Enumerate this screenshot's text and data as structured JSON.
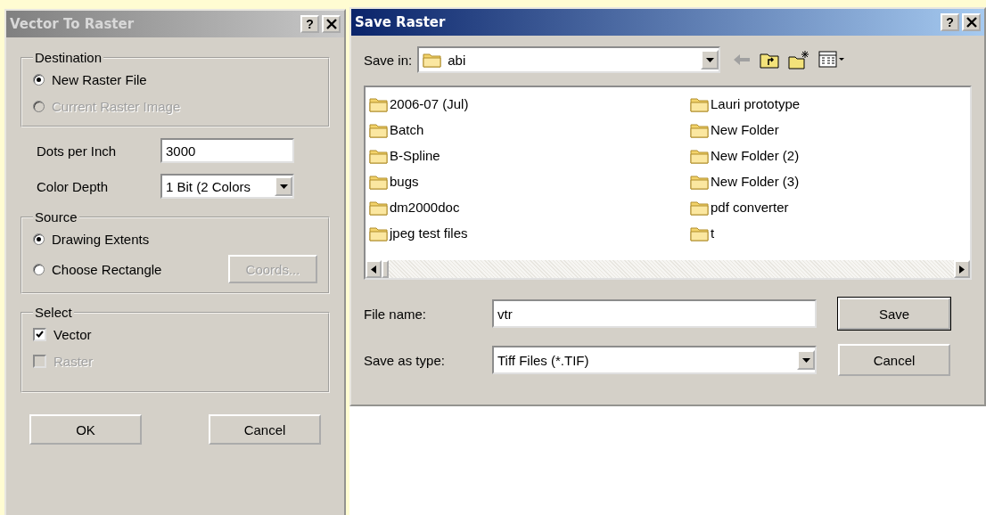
{
  "vector_to_raster": {
    "title": "Vector To Raster",
    "help": "?",
    "destination": {
      "label": "Destination",
      "options": [
        {
          "label": "New Raster File",
          "selected": true,
          "disabled": false
        },
        {
          "label": "Current Raster Image",
          "selected": false,
          "disabled": true
        }
      ]
    },
    "dpi": {
      "label": "Dots per Inch",
      "value": "3000"
    },
    "color_depth": {
      "label": "Color Depth",
      "value": "1 Bit (2 Colors"
    },
    "source": {
      "label": "Source",
      "options": [
        {
          "label": "Drawing Extents",
          "selected": true,
          "disabled": false
        },
        {
          "label": "Choose Rectangle",
          "selected": false,
          "disabled": false
        }
      ],
      "coords_button": {
        "label": "Coords...",
        "disabled": true
      }
    },
    "select": {
      "label": "Select",
      "options": [
        {
          "label": "Vector",
          "checked": true,
          "disabled": false
        },
        {
          "label": "Raster",
          "checked": false,
          "disabled": true
        }
      ]
    },
    "buttons": [
      "OK",
      "Cancel"
    ]
  },
  "save_raster": {
    "title": "Save Raster",
    "help": "?",
    "save_in": {
      "label": "Save in:",
      "value": "abi"
    },
    "files": [
      "2006-07 (Jul)",
      "Batch",
      "B-Spline",
      "bugs",
      "dm2000doc",
      "jpeg test files",
      "Lauri prototype",
      "New Folder",
      "New Folder (2)",
      "New Folder (3)",
      "pdf converter",
      "t"
    ],
    "file_name": {
      "label": "File name:",
      "value": "vtr"
    },
    "save_as_type": {
      "label": "Save as type:",
      "value": "Tiff Files (*.TIF)"
    },
    "buttons": [
      {
        "label": "Save",
        "default": true
      },
      {
        "label": "Cancel",
        "default": false
      }
    ]
  }
}
